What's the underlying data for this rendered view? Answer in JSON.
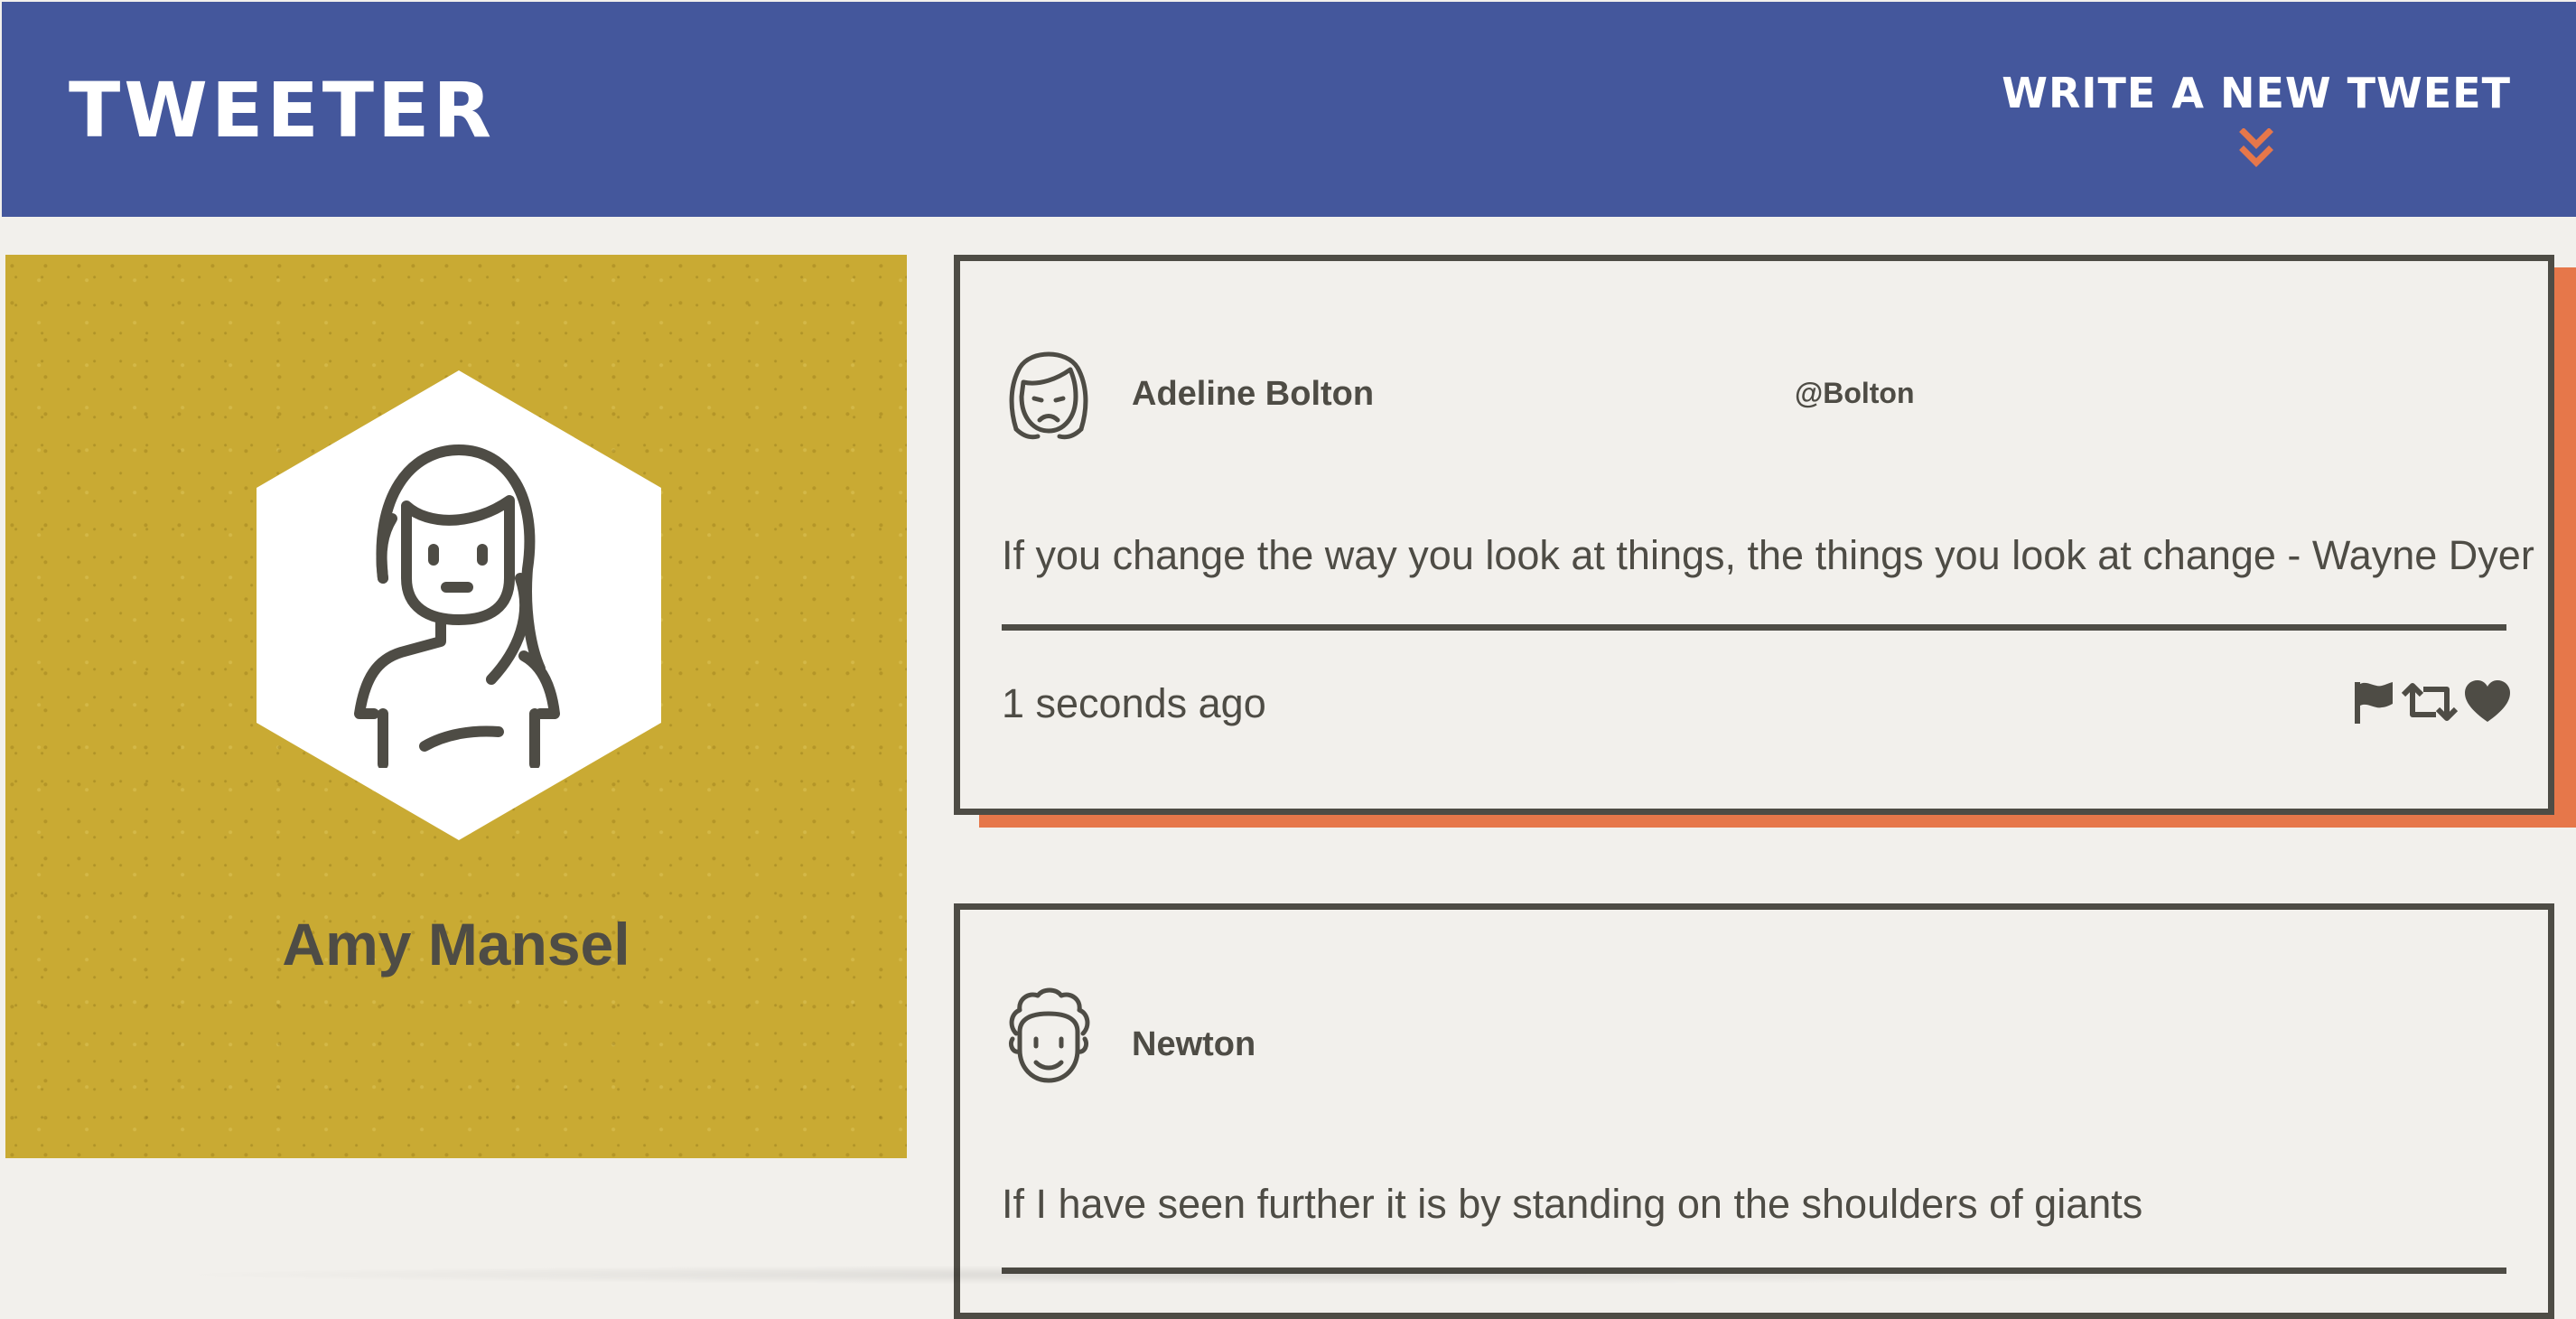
{
  "nav": {
    "brand": "TWEETER",
    "compose_label": "WRITE A NEW TWEET",
    "compose_icon": "double-chevron-down-icon",
    "accent_color": "#e6774a",
    "bar_color": "#44579c"
  },
  "profile": {
    "name": "Amy Mansel",
    "avatar_icon": "woman-avatar-icon",
    "card_color": "#c9aa33"
  },
  "tweets": [
    {
      "author": "Adeline Bolton",
      "handle": "@Bolton",
      "avatar_icon": "sad-woman-avatar-icon",
      "content": "If you change the way you look at things, the things you look at change - Wayne Dyer",
      "time": "1 seconds ago",
      "actions": [
        "flag-icon",
        "retweet-icon",
        "heart-icon"
      ]
    },
    {
      "author": "Newton",
      "handle": "",
      "avatar_icon": "curly-hair-man-avatar-icon",
      "content": "If I have seen further it is by standing on the shoulders of giants",
      "time": "",
      "actions": []
    }
  ]
}
